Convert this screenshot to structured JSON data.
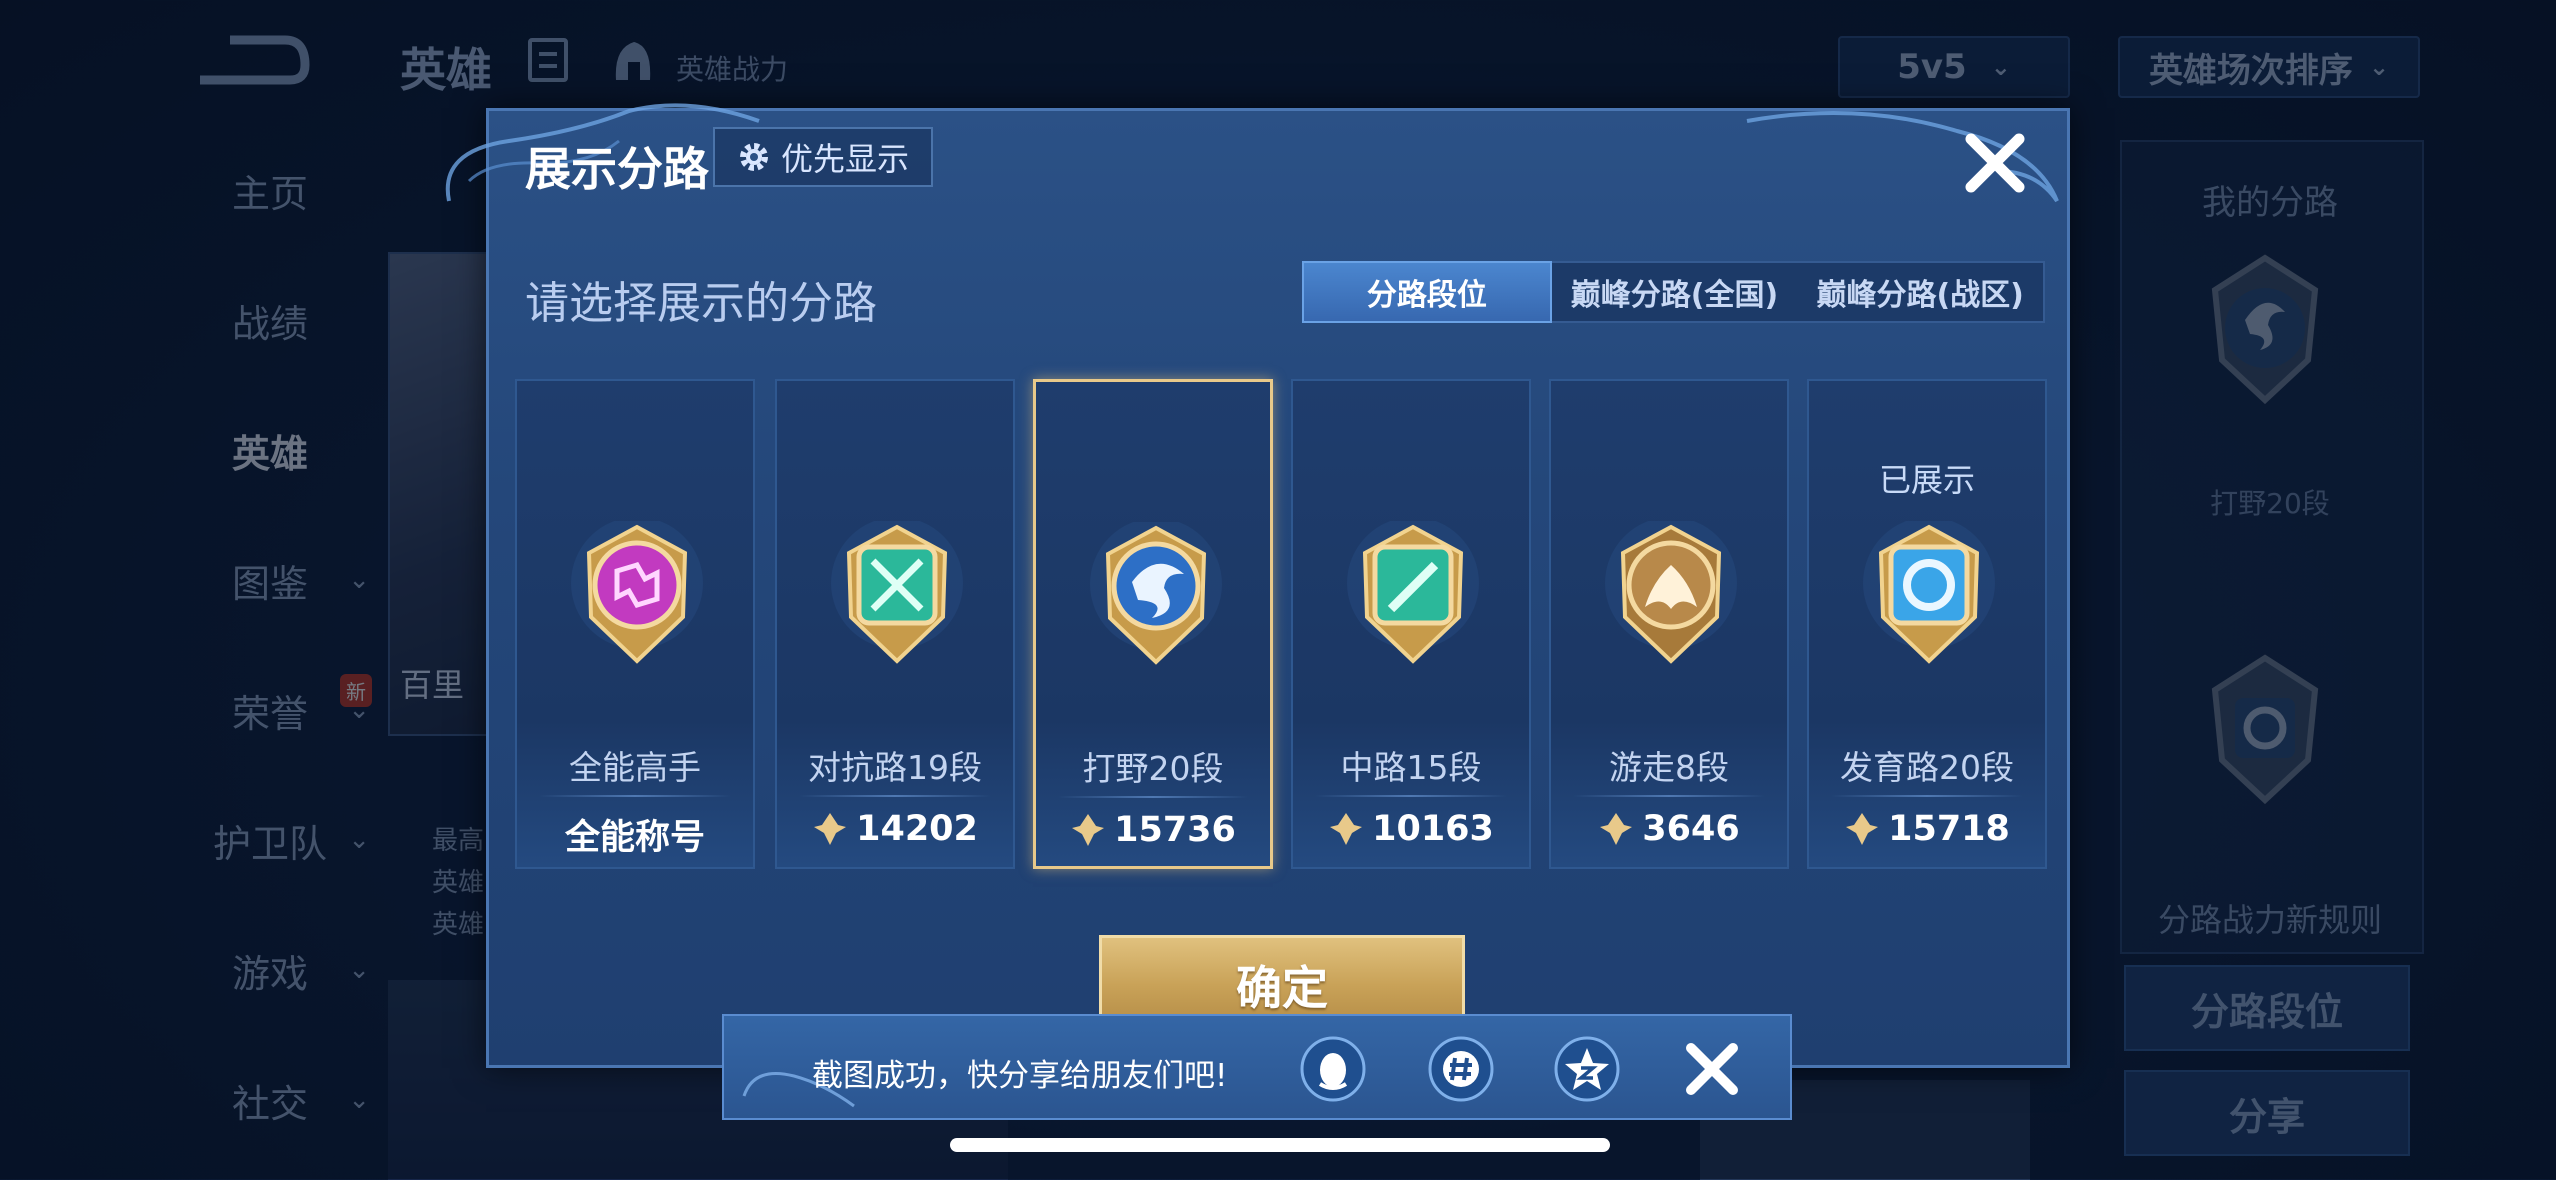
{
  "background": {
    "title": "英雄",
    "subtitle": "英雄战力",
    "mode_select": "5v5",
    "sort_select": "英雄场次排序",
    "sidebar": [
      {
        "label": "主页",
        "has_chevron": false
      },
      {
        "label": "战绩",
        "has_chevron": false
      },
      {
        "label": "英雄",
        "has_chevron": false,
        "active": true
      },
      {
        "label": "图鉴",
        "has_chevron": true
      },
      {
        "label": "荣誉",
        "has_chevron": true,
        "badge": "新"
      },
      {
        "label": "护卫队",
        "has_chevron": true
      },
      {
        "label": "游戏",
        "has_chevron": true
      },
      {
        "label": "社交",
        "has_chevron": true
      }
    ],
    "hero_name": "百里",
    "hero_notes": [
      "最高",
      "英雄",
      "英雄"
    ],
    "right_panel": {
      "title": "我的分路",
      "current_lane": "打野20段",
      "rule_link": "分路战力新规则",
      "button_primary": "分路段位",
      "button_share": "分享"
    }
  },
  "modal": {
    "title": "展示分路",
    "priority_label": "优先显示",
    "subtitle": "请选择展示的分路",
    "tabs": [
      {
        "label": "分路段位",
        "active": true
      },
      {
        "label": "巅峰分路(全国)",
        "active": false
      },
      {
        "label": "巅峰分路(战区)",
        "active": false
      }
    ],
    "cards": [
      {
        "lane": "全能高手",
        "score": "全能称号",
        "score_has_icon": false,
        "shown": "",
        "selected": false,
        "emblem_color": "#c23ac0",
        "emblem_icon": "all-round-icon"
      },
      {
        "lane": "对抗路19段",
        "score": "14202",
        "score_has_icon": true,
        "shown": "",
        "selected": false,
        "emblem_color": "#2bb89a",
        "emblem_icon": "clash-lane-icon"
      },
      {
        "lane": "打野20段",
        "score": "15736",
        "score_has_icon": true,
        "shown": "",
        "selected": true,
        "emblem_color": "#2d6fc6",
        "emblem_icon": "jungle-dragon-icon"
      },
      {
        "lane": "中路15段",
        "score": "10163",
        "score_has_icon": true,
        "shown": "",
        "selected": false,
        "emblem_color": "#2bb89a",
        "emblem_icon": "mid-lane-icon"
      },
      {
        "lane": "游走8段",
        "score": "3646",
        "score_has_icon": true,
        "shown": "",
        "selected": false,
        "emblem_color": "#b8894a",
        "emblem_icon": "roam-wings-icon"
      },
      {
        "lane": "发育路20段",
        "score": "15718",
        "score_has_icon": true,
        "shown": "已展示",
        "selected": false,
        "emblem_color": "#3aa5e8",
        "emblem_icon": "farm-lane-icon"
      }
    ],
    "confirm_label": "确定"
  },
  "toast": {
    "message": "截图成功，快分享给朋友们吧!",
    "share_targets": [
      "qq-icon",
      "wechat-moments-icon",
      "qzone-icon"
    ]
  },
  "colors": {
    "accent_gold": "#e8c98a",
    "modal_bg": "#24477a",
    "tab_active": "#3f76bf"
  }
}
